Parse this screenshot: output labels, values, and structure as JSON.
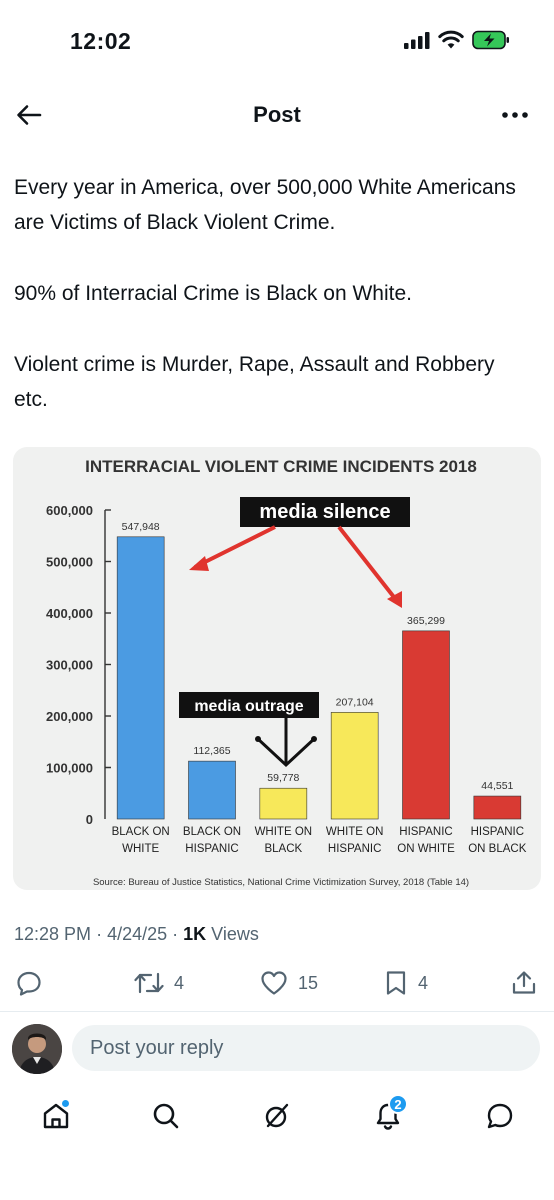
{
  "status_bar": {
    "time": "12:02"
  },
  "header": {
    "title": "Post"
  },
  "post": {
    "paragraphs": [
      "Every year in America, over 500,000 White Americans are Victims of Black Violent Crime.",
      "90% of Interracial Crime is Black on White.",
      "Violent crime is Murder, Rape, Assault and Robbery etc."
    ],
    "time": "12:28 PM",
    "date": "4/24/25",
    "views_count": "1K",
    "views_label": "Views"
  },
  "actions": {
    "reposts": "4",
    "likes": "15",
    "bookmarks": "4"
  },
  "reply": {
    "placeholder": "Post your reply"
  },
  "tabbar": {
    "notifications_badge": "2"
  },
  "chart_data": {
    "type": "bar",
    "title": "INTERRACIAL VIOLENT CRIME INCIDENTS 2018",
    "categories": [
      [
        "BLACK ON",
        "WHITE"
      ],
      [
        "BLACK ON",
        "HISPANIC"
      ],
      [
        "WHITE ON",
        "BLACK"
      ],
      [
        "WHITE ON",
        "HISPANIC"
      ],
      [
        "HISPANIC",
        "ON WHITE"
      ],
      [
        "HISPANIC",
        "ON BLACK"
      ]
    ],
    "values": [
      547948,
      112365,
      59778,
      207104,
      365299,
      44551
    ],
    "value_labels": [
      "547,948",
      "112,365",
      "59,778",
      "207,104",
      "365,299",
      "44,551"
    ],
    "colors": [
      "#4b9be2",
      "#4b9be2",
      "#f7e85a",
      "#f7e85a",
      "#d93a33",
      "#d93a33"
    ],
    "ylim": [
      0,
      600000
    ],
    "yticks": [
      "0",
      "100,000",
      "200,000",
      "300,000",
      "400,000",
      "500,000",
      "600,000"
    ],
    "ytick_values": [
      0,
      100000,
      200000,
      300000,
      400000,
      500000,
      600000
    ],
    "grid": false,
    "annotations": [
      "media silence",
      "media outrage"
    ],
    "source": "Source: Bureau of Justice Statistics, National Crime Victimization Survey, 2018 (Table 14)"
  }
}
